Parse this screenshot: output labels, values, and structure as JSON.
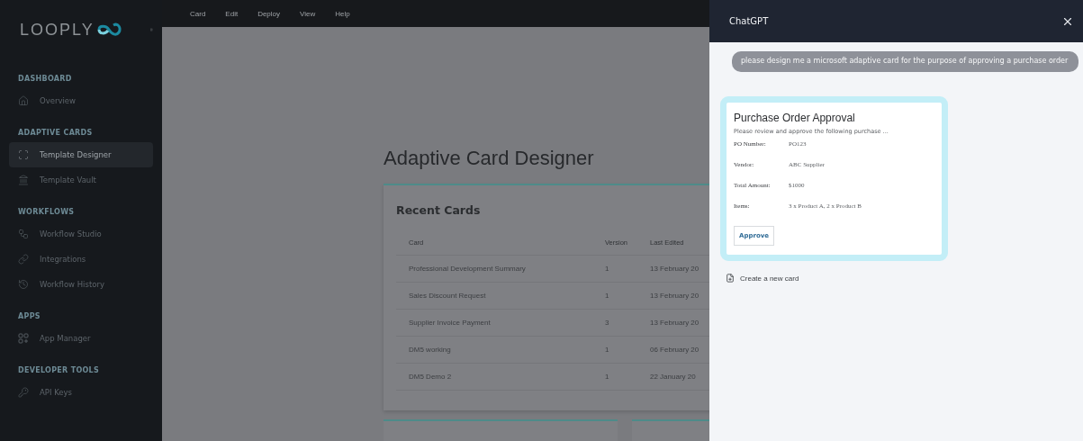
{
  "sidebar": {
    "logo": "LOOPLY",
    "sections": [
      {
        "title": "DASHBOARD",
        "items": [
          {
            "label": "Overview",
            "selected": false
          }
        ]
      },
      {
        "title": "ADAPTIVE CARDS",
        "items": [
          {
            "label": "Template Designer",
            "selected": true
          },
          {
            "label": "Template Vault",
            "selected": false
          }
        ]
      },
      {
        "title": "WORKFLOWS",
        "items": [
          {
            "label": "Workflow Studio",
            "selected": false
          },
          {
            "label": "Integrations",
            "selected": false
          },
          {
            "label": "Workflow History",
            "selected": false
          }
        ]
      },
      {
        "title": "APPS",
        "items": [
          {
            "label": "App Manager",
            "selected": false
          }
        ]
      },
      {
        "title": "DEVELOPER TOOLS",
        "items": [
          {
            "label": "API Keys",
            "selected": false
          }
        ]
      }
    ]
  },
  "menu": [
    "Card",
    "Edit",
    "Deploy",
    "View",
    "Help"
  ],
  "main": {
    "title": "Adaptive Card Designer",
    "recent_cards": {
      "title": "Recent Cards",
      "columns": [
        "Card",
        "Version",
        "Last Edited"
      ],
      "rows": [
        [
          "Professional Development Summary",
          "1",
          "13 February 20"
        ],
        [
          "Sales Discount Request",
          "1",
          "13 February 20"
        ],
        [
          "Supplier Invoice Payment",
          "3",
          "13 February 20"
        ],
        [
          "DM5 working",
          "1",
          "06 February 20"
        ],
        [
          "DM5 Demo 2",
          "1",
          "22 January 20"
        ]
      ]
    }
  },
  "chat": {
    "title": "ChatGPT",
    "user_message": "please design me a microsoft adaptive card for the purpose of approving a purchase order",
    "card": {
      "title": "Purchase Order Approval",
      "subtitle": "Please review and approve the following purchase ...",
      "facts": [
        {
          "label": "PO Number:",
          "value": "PO123"
        },
        {
          "label": "Vendor:",
          "value": "ABC Supplier"
        },
        {
          "label": "Total Amount:",
          "value": "$1000"
        },
        {
          "label": "Items:",
          "value": "3 x Product A, 2 x Product B"
        }
      ],
      "action": "Approve"
    },
    "create_link": "Create a new card"
  }
}
